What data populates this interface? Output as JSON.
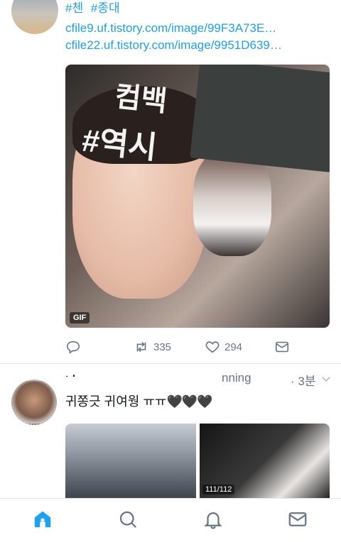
{
  "colors": {
    "accent": "#1da1f2",
    "muted": "#657786",
    "text": "#14171a",
    "divider": "#e1e8ed"
  },
  "tweet1": {
    "hashtags": [
      "#첸",
      "#종대"
    ],
    "links": [
      "cfile9.uf.tistory.com/image/99F3A73E…",
      "cfile22.uf.tistory.com/image/9951D639…"
    ],
    "media": {
      "badge": "GIF",
      "sign_line1": "컴백",
      "sign_line2": "#역시"
    },
    "actions": {
      "reply_icon": "reply-icon",
      "retweet_count": "335",
      "like_count": "294",
      "dm_icon": "envelope-icon"
    }
  },
  "tweet2": {
    "name": "나ㄴ",
    "handle": "nning",
    "time": "· 3분",
    "text": "귀쫑긋 귀여웡 ㅠㅠ",
    "hearts": "🖤🖤🖤",
    "media_counter": "111/112"
  },
  "tabbar": {
    "items": [
      "home-icon",
      "search-icon",
      "notifications-icon",
      "messages-icon"
    ]
  }
}
